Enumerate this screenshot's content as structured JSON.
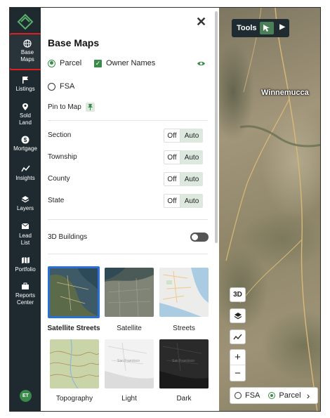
{
  "sidebar": {
    "items": [
      {
        "label": "Base\nMaps",
        "icon": "globe-icon"
      },
      {
        "label": "Listings",
        "icon": "flag-icon"
      },
      {
        "label": "Sold\nLand",
        "icon": "pin-icon"
      },
      {
        "label": "Mortgage",
        "icon": "dollar-icon"
      },
      {
        "label": "Insights",
        "icon": "chart-icon"
      },
      {
        "label": "Layers",
        "icon": "layers-icon"
      },
      {
        "label": "Lead\nList",
        "icon": "mail-icon"
      },
      {
        "label": "Portfolio",
        "icon": "map-icon"
      },
      {
        "label": "Reports\nCenter",
        "icon": "briefcase-icon"
      }
    ],
    "avatar": "ET"
  },
  "panel": {
    "title": "Base Maps",
    "close": "✕",
    "parcel_label": "Parcel",
    "owner_names_label": "Owner Names",
    "fsa_label": "FSA",
    "pin_label": "Pin to Map",
    "boundaries": [
      {
        "label": "Section",
        "off": "Off",
        "auto": "Auto"
      },
      {
        "label": "Township",
        "off": "Off",
        "auto": "Auto"
      },
      {
        "label": "County",
        "off": "Off",
        "auto": "Auto"
      },
      {
        "label": "State",
        "off": "Off",
        "auto": "Auto"
      }
    ],
    "buildings_label": "3D Buildings",
    "styles": [
      "Satellite Streets",
      "Satellite",
      "Streets",
      "Topography",
      "Light",
      "Dark"
    ]
  },
  "map": {
    "city": "Winnemucca",
    "tools_label": "Tools",
    "btn_3d": "3D",
    "zoom_in": "+",
    "zoom_out": "−",
    "toggle_fsa": "FSA",
    "toggle_parcel": "Parcel",
    "toggle_chevron": "›"
  },
  "colors": {
    "accent": "#3a8a4a",
    "sidebar": "#1e2a30",
    "selected": "#2a6fd6"
  }
}
